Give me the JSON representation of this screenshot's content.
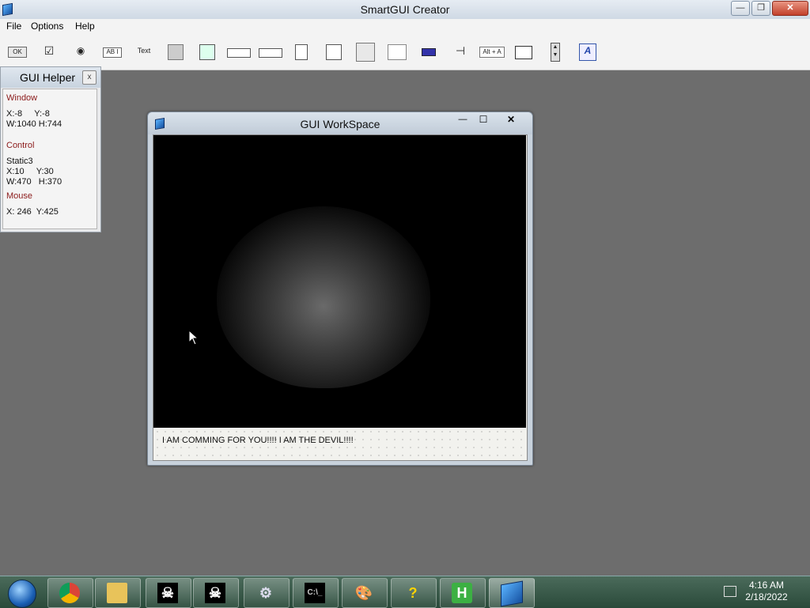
{
  "app": {
    "title": "SmartGUI Creator",
    "window_buttons": {
      "minimize": "—",
      "restore": "❐",
      "close": "✕"
    }
  },
  "menu": [
    "File",
    "Options",
    "Help"
  ],
  "toolbar": {
    "ok_label": "OK",
    "edit_label": "AB I",
    "text_label": "Text",
    "hotkey_label": "Alt + A"
  },
  "helper": {
    "title": "GUI Helper",
    "close": "x",
    "window_header": "Window",
    "window_xy": "X:-8     Y:-8",
    "window_wh": "W:1040 H:744",
    "control_header": "Control",
    "control_name": "Static3",
    "control_xy": "X:10     Y:30",
    "control_wh": "W:470   H:370",
    "mouse_header": "Mouse",
    "mouse_xy": "X: 246  Y:425"
  },
  "workspace": {
    "title": "GUI WorkSpace",
    "buttons": {
      "minimize": "—",
      "maximize": "☐",
      "close": "✕"
    },
    "label_text": "I AM COMMING FOR YOU!!!! I AM THE DEVIL!!!!"
  },
  "taskbar": {
    "time": "4:16 AM",
    "date": "2/18/2022"
  }
}
